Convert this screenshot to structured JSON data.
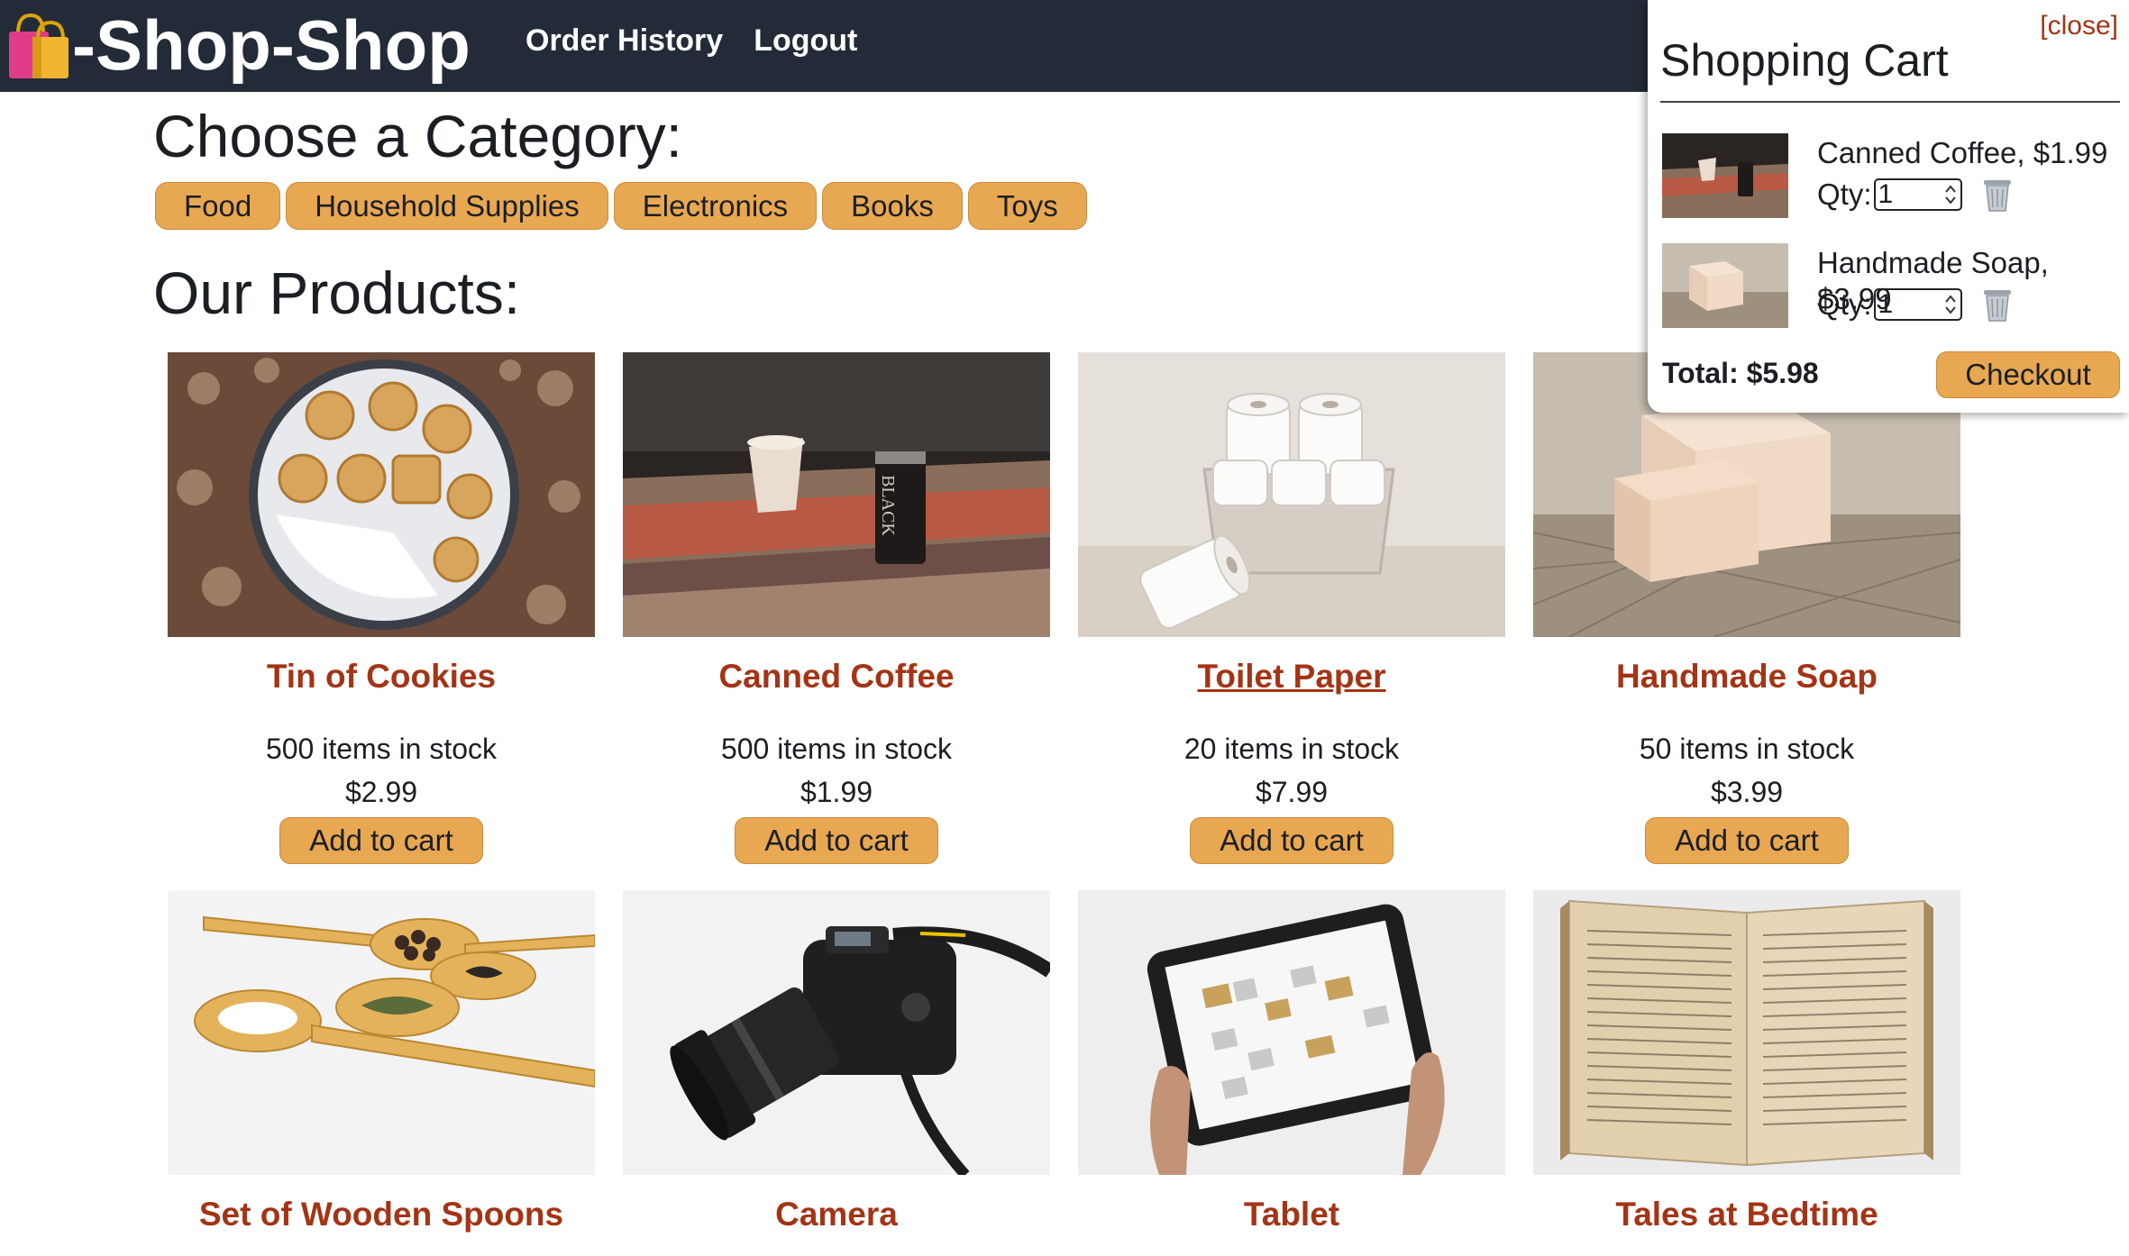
{
  "header": {
    "brand": "-Shop-Shop",
    "brand_icon": "shopping-bags-icon",
    "nav": [
      "Order History",
      "Logout"
    ]
  },
  "categories": {
    "title": "Choose a Category:",
    "items": [
      "Food",
      "Household Supplies",
      "Electronics",
      "Books",
      "Toys"
    ]
  },
  "products": {
    "title": "Our Products:",
    "items": [
      {
        "name": "Tin of Cookies",
        "stock": "500 items in stock",
        "price": "$2.99",
        "button": "Add to cart"
      },
      {
        "name": "Canned Coffee",
        "stock": "500 items in stock",
        "price": "$1.99",
        "button": "Add to cart"
      },
      {
        "name": "Toilet Paper",
        "stock": "20 items in stock",
        "price": "$7.99",
        "button": "Add to cart"
      },
      {
        "name": "Handmade Soap",
        "stock": "50 items in stock",
        "price": "$3.99",
        "button": "Add to cart"
      },
      {
        "name": "Set of Wooden Spoons"
      },
      {
        "name": "Camera"
      },
      {
        "name": "Tablet"
      },
      {
        "name": "Tales at Bedtime"
      }
    ]
  },
  "cart": {
    "close": "[close]",
    "title": "Shopping Cart",
    "qty_label": "Qty:",
    "items": [
      {
        "name": "Canned Coffee, $1.99",
        "qty": "1"
      },
      {
        "name": "Handmade Soap, $3.99",
        "qty": "1"
      }
    ],
    "total": "Total: $5.98",
    "checkout": "Checkout"
  },
  "colors": {
    "header_bg": "#242b38",
    "button": "#e8a751",
    "product_name": "#a43415"
  }
}
